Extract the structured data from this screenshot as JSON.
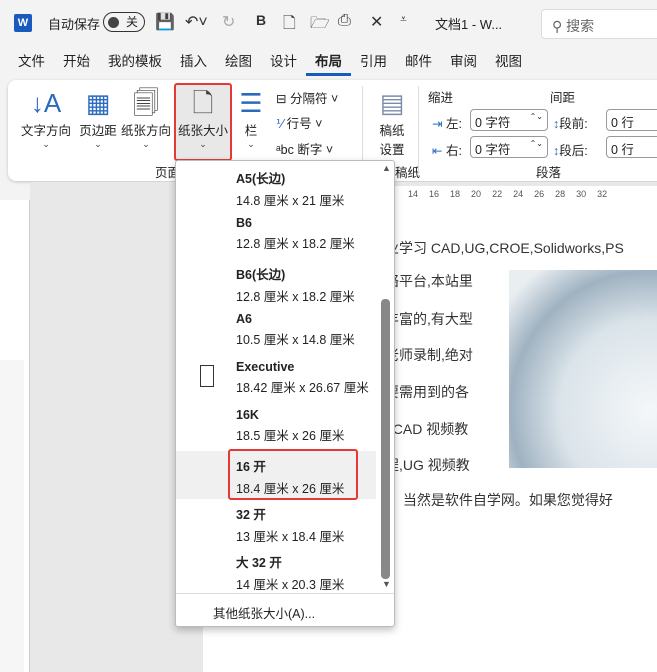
{
  "titlebar": {
    "autosave_label": "自动保存",
    "autosave_state": "关",
    "bold": "B",
    "doc_title": "文档1 - W...",
    "search_placeholder": "搜索",
    "logo": "W"
  },
  "tabs": [
    "文件",
    "开始",
    "我的模板",
    "插入",
    "绘图",
    "设计",
    "布局",
    "引用",
    "邮件",
    "审阅",
    "视图"
  ],
  "ribbon": {
    "text_direction": "文字方向",
    "margins": "页边距",
    "orientation": "纸张方向",
    "size": "纸张大小",
    "columns": "栏",
    "breaks": "分隔符",
    "line_numbers": "行号",
    "hyphenation": "断字",
    "manuscript": "稿纸设置",
    "group_page": "页面",
    "group_manuscript": "稿纸",
    "indent": "缩进",
    "spacing": "间距",
    "left": "左:",
    "right": "右:",
    "before": "段前:",
    "after": "段后:",
    "left_val": "0 字符",
    "right_val": "0 字符",
    "before_val": "0 行",
    "after_val": "0 行",
    "group_paragraph": "段落"
  },
  "ruler": [
    "14",
    "16",
    "18",
    "20",
    "22",
    "24",
    "26",
    "28",
    "30",
    "32"
  ],
  "doc": {
    "l1": "业学习  CAD,UG,CROE,Solidworks,PS",
    "l2": "络平台,本站里",
    "l3": "丰富的,有大型",
    "l4": "老师录制,绝对",
    "l5": "要需用到的各",
    "l6": "oCAD  视频教",
    "l7": "程,UG  视频教",
    "l8": "？ 当然是软件自学网。如果您觉得好"
  },
  "paper_sizes": [
    {
      "name": "A5(长边)",
      "dims": "14.8 厘米 x 21 厘米"
    },
    {
      "name": "B6",
      "dims": "12.8 厘米 x 18.2 厘米"
    },
    {
      "name": "B6(长边)",
      "dims": "12.8 厘米 x 18.2 厘米"
    },
    {
      "name": "A6",
      "dims": "10.5 厘米 x 14.8 厘米"
    },
    {
      "name": "Executive",
      "dims": "18.42 厘米 x 26.67 厘米"
    },
    {
      "name": "16K",
      "dims": "18.5 厘米 x 26 厘米"
    },
    {
      "name": "16 开",
      "dims": "18.4 厘米 x 26 厘米"
    },
    {
      "name": "32 开",
      "dims": "13 厘米 x 18.4 厘米"
    },
    {
      "name": "大 32 开",
      "dims": "14 厘米 x 20.3 厘米"
    }
  ],
  "more_sizes": "其他纸张大小(A)..."
}
